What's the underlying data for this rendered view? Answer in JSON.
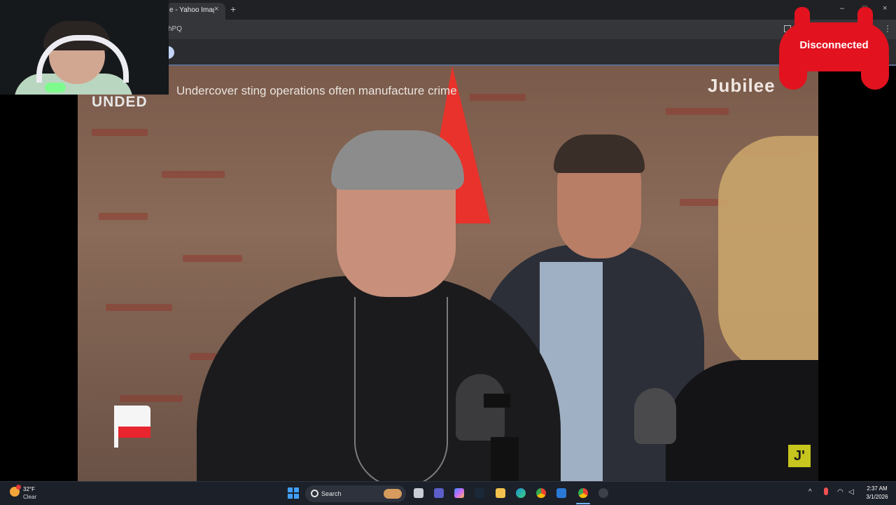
{
  "browser": {
    "tab_title": "e - Yahoo Image",
    "tab_close": "×",
    "new_tab": "+",
    "window_controls": [
      "–",
      "□",
      "×"
    ],
    "url_fragment": "hPQ",
    "menu_icon": "⋮"
  },
  "video": {
    "title_overlay": "UNDED",
    "subtitle": "Undercover sting operations often manufacture crime",
    "channel_logo": "Jubilee",
    "corner_logo": "J'"
  },
  "stream_overlay": {
    "status_badge": "Disconnected",
    "badge_color": "#e2121f"
  },
  "taskbar": {
    "weather_temp": "32°F",
    "weather_condition": "Clear",
    "search_label": "Search",
    "tray_chevron": "^",
    "wifi_icon": "wifi-icon",
    "volume_icon": "volume-icon",
    "clock_time": "2:37 AM",
    "clock_date": "3/1/2026",
    "apps": [
      "file-explorer-icon",
      "teams-icon",
      "copilot-icon",
      "steam-icon",
      "folder-icon",
      "edge-icon",
      "chrome-icon",
      "store-icon",
      "chrome-active-icon",
      "settings-icon"
    ]
  },
  "colors": {
    "accent_blue": "#3fa0ff",
    "jubilee_yellow": "#c6c61e",
    "flag_red": "#e8322b"
  }
}
